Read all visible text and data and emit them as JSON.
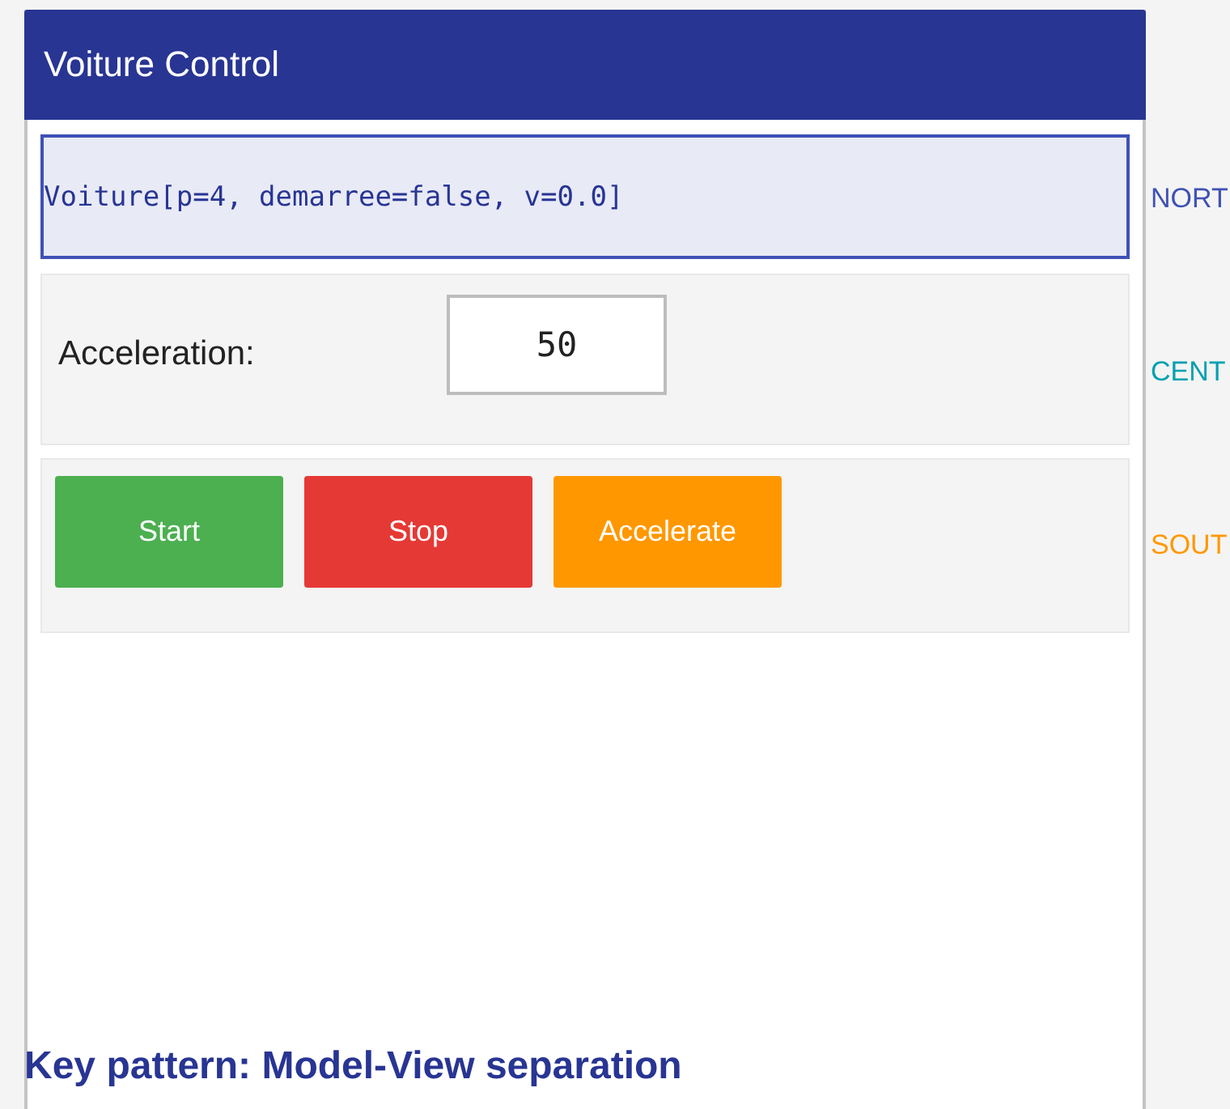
{
  "window": {
    "title": "Voiture Control"
  },
  "north": {
    "text": "Voiture[p=4, demarree=false, v=0.0]"
  },
  "center": {
    "label": "Acceleration:",
    "field": {
      "value": "50"
    }
  },
  "south": {
    "buttons": [
      {
        "label": "Start",
        "color": "#4caf50"
      },
      {
        "label": "Stop",
        "color": "#e53935"
      },
      {
        "label": "Accelerate",
        "color": "#ff9800"
      }
    ]
  },
  "region_labels": [
    {
      "text": "NORT",
      "color": "#3f51b5"
    },
    {
      "text": "CENT",
      "color": "#00a0b0"
    },
    {
      "text": "SOUT",
      "color": "#ff9800"
    }
  ],
  "caption": "Key pattern: Model-View separation"
}
